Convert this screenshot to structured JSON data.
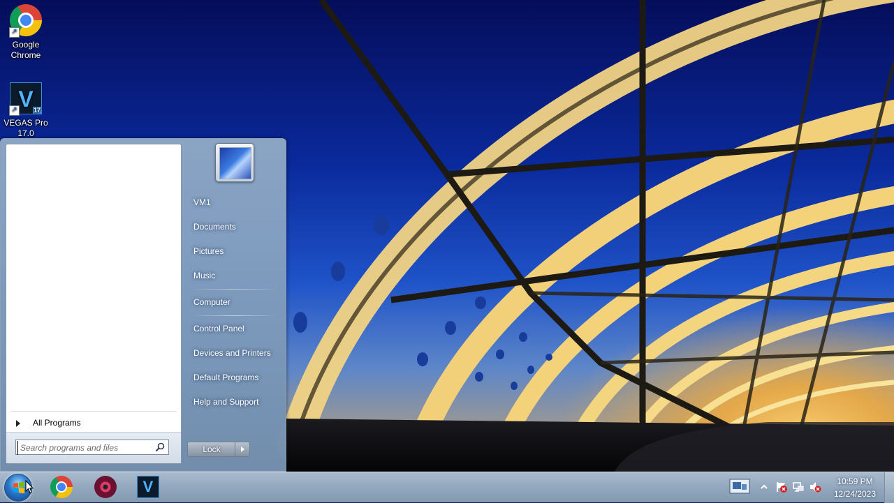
{
  "desktop": {
    "icons": [
      {
        "label_line1": "Google",
        "label_line2": "Chrome",
        "icon": "chrome-icon"
      },
      {
        "label_line1": "VEGAS Pro",
        "label_line2": "17.0",
        "icon": "vegas-pro-icon",
        "badge": "17"
      }
    ]
  },
  "start_menu": {
    "all_programs": "All Programs",
    "search_placeholder": "Search programs and files",
    "user_name": "VM1",
    "right_items": [
      "Documents",
      "Pictures",
      "Music",
      "Computer",
      "Control Panel",
      "Devices and Printers",
      "Default Programs",
      "Help and Support"
    ],
    "lock_label": "Lock"
  },
  "taskbar": {
    "apps": [
      "chrome-icon",
      "media-player-icon",
      "vegas-pro-icon"
    ],
    "vegas_letter": "V",
    "clock_time": "10:59 PM",
    "clock_date": "12/24/2023"
  },
  "colors": {
    "sky_top": "#050d5a",
    "bridge_light": "#f3d27a",
    "taskbar": "#93a8be"
  }
}
